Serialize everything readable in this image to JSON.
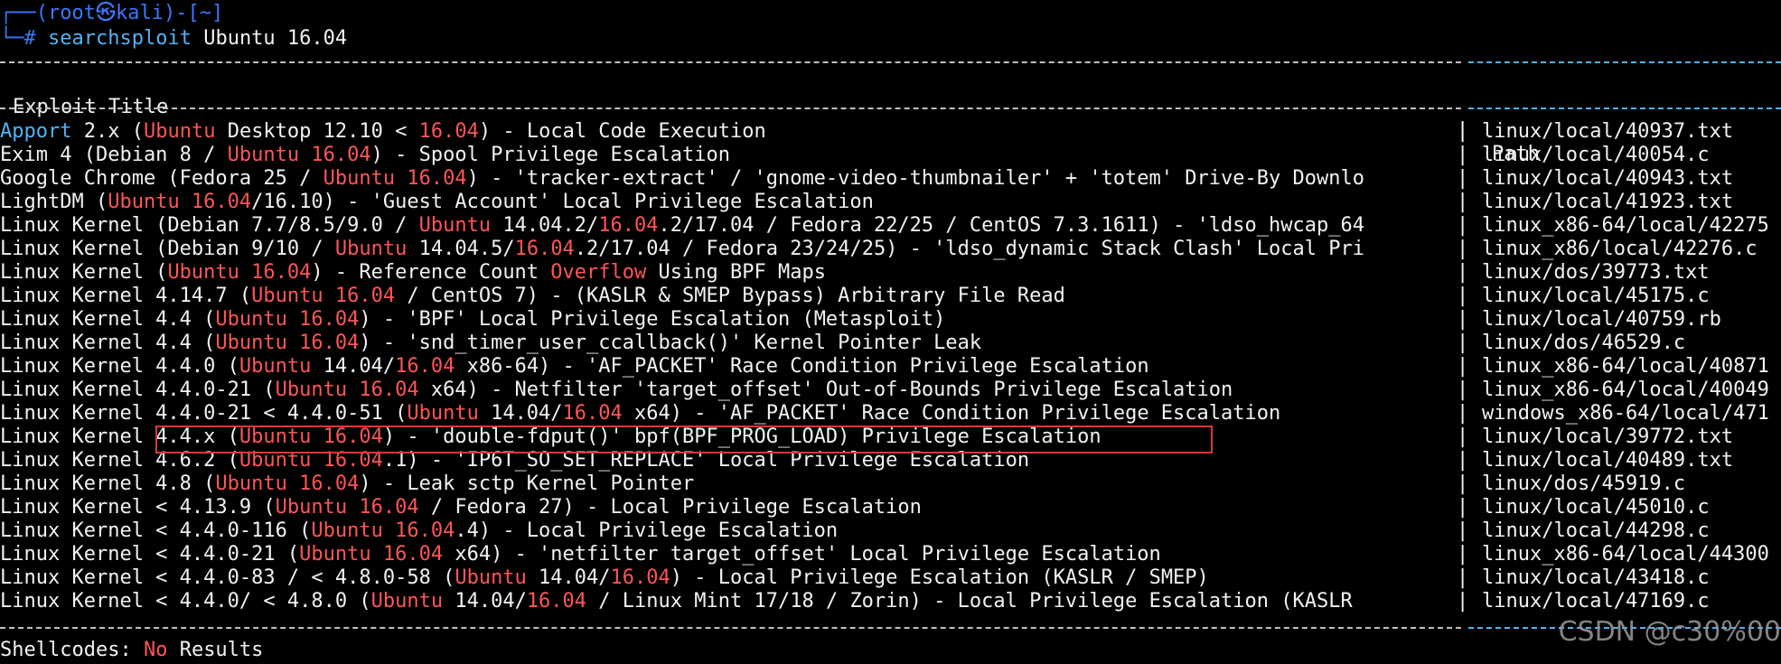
{
  "prompt": {
    "line1_prefix": "┌──(",
    "user": "root",
    "at_symbol": "㉿",
    "host": "kali",
    "line1_mid": ")-[",
    "cwd": "~",
    "line1_suffix": "]",
    "line2_prefix": "└─",
    "hash": "#",
    "command": "searchsploit",
    "argument": "Ubuntu 16.04"
  },
  "table": {
    "header_title": "Exploit Title",
    "header_path": "Path",
    "separator": "|",
    "rows": [
      {
        "title": [
          {
            "t": "Apport",
            "c": "apport"
          },
          {
            "t": " 2.x ("
          },
          {
            "t": "Ubuntu",
            "c": "hl"
          },
          {
            "t": " Desktop 12.10 < "
          },
          {
            "t": "16.04",
            "c": "hl"
          },
          {
            "t": ") - Local Code Execution"
          }
        ],
        "path": "linux/local/40937.txt"
      },
      {
        "title": [
          {
            "t": "Exim 4 (Debian 8 / "
          },
          {
            "t": "Ubuntu 16.04",
            "c": "hl"
          },
          {
            "t": ") - Spool Privilege Escalation"
          }
        ],
        "path": "linux/local/40054.c"
      },
      {
        "title": [
          {
            "t": "Google Chrome (Fedora 25 / "
          },
          {
            "t": "Ubuntu 16.04",
            "c": "hl"
          },
          {
            "t": ") - 'tracker-extract' / 'gnome-video-thumbnailer' + 'totem' Drive-By Downlo"
          }
        ],
        "path": "linux/local/40943.txt"
      },
      {
        "title": [
          {
            "t": "LightDM ("
          },
          {
            "t": "Ubuntu 16.04",
            "c": "hl"
          },
          {
            "t": "/16.10) - 'Guest Account' Local Privilege Escalation"
          }
        ],
        "path": "linux/local/41923.txt"
      },
      {
        "title": [
          {
            "t": "Linux Kernel (Debian 7.7/8.5/9.0 / "
          },
          {
            "t": "Ubuntu",
            "c": "hl"
          },
          {
            "t": " 14.04.2/"
          },
          {
            "t": "16.04",
            "c": "hl"
          },
          {
            "t": ".2/17.04 / Fedora 22/25 / CentOS 7.3.1611) - 'ldso_hwcap_64"
          }
        ],
        "path": "linux_x86-64/local/42275"
      },
      {
        "title": [
          {
            "t": "Linux Kernel (Debian 9/10 / "
          },
          {
            "t": "Ubuntu",
            "c": "hl"
          },
          {
            "t": " 14.04.5/"
          },
          {
            "t": "16.04",
            "c": "hl"
          },
          {
            "t": ".2/17.04 / Fedora 23/24/25) - 'ldso_dynamic Stack Clash' Local Pri"
          }
        ],
        "path": "linux_x86/local/42276.c"
      },
      {
        "title": [
          {
            "t": "Linux Kernel ("
          },
          {
            "t": "Ubuntu 16.04",
            "c": "hl"
          },
          {
            "t": ") - Reference Count "
          },
          {
            "t": "Overflow",
            "c": "hl"
          },
          {
            "t": " Using BPF Maps"
          }
        ],
        "path": "linux/dos/39773.txt"
      },
      {
        "title": [
          {
            "t": "Linux Kernel 4.14.7 ("
          },
          {
            "t": "Ubuntu 16.04",
            "c": "hl"
          },
          {
            "t": " / CentOS 7) - (KASLR & SMEP Bypass) Arbitrary File Read"
          }
        ],
        "path": "linux/local/45175.c"
      },
      {
        "title": [
          {
            "t": "Linux Kernel 4.4 ("
          },
          {
            "t": "Ubuntu 16.04",
            "c": "hl"
          },
          {
            "t": ") - 'BPF' Local Privilege Escalation (Metasploit)"
          }
        ],
        "path": "linux/local/40759.rb"
      },
      {
        "title": [
          {
            "t": "Linux Kernel 4.4 ("
          },
          {
            "t": "Ubuntu 16.04",
            "c": "hl"
          },
          {
            "t": ") - 'snd_timer_user_ccallback()' Kernel Pointer Leak"
          }
        ],
        "path": "linux/dos/46529.c"
      },
      {
        "title": [
          {
            "t": "Linux Kernel 4.4.0 ("
          },
          {
            "t": "Ubuntu",
            "c": "hl"
          },
          {
            "t": " 14.04/"
          },
          {
            "t": "16.04",
            "c": "hl"
          },
          {
            "t": " x86-64) - 'AF_PACKET' Race Condition Privilege Escalation"
          }
        ],
        "path": "linux_x86-64/local/40871"
      },
      {
        "title": [
          {
            "t": "Linux Kernel 4.4.0-21 ("
          },
          {
            "t": "Ubuntu 16.04",
            "c": "hl"
          },
          {
            "t": " x64) - Netfilter 'target_offset' Out-of-Bounds Privilege Escalation"
          }
        ],
        "path": "linux_x86-64/local/40049"
      },
      {
        "title": [
          {
            "t": "Linux Kernel 4.4.0-21 < 4.4.0-51 ("
          },
          {
            "t": "Ubuntu",
            "c": "hl"
          },
          {
            "t": " 14.04/"
          },
          {
            "t": "16.04",
            "c": "hl"
          },
          {
            "t": " x64) - 'AF_PACKET' Race Condition Privilege Escalation"
          }
        ],
        "path": "windows_x86-64/local/471"
      },
      {
        "title": [
          {
            "t": "Linux Kernel 4.4.x ("
          },
          {
            "t": "Ubuntu 16.04",
            "c": "hl"
          },
          {
            "t": ") - 'double-fdput()' bpf(BPF_PROG_LOAD) Privilege Escalation"
          }
        ],
        "path": "linux/local/39772.txt"
      },
      {
        "title": [
          {
            "t": "Linux Kernel 4.6.2 ("
          },
          {
            "t": "Ubuntu 16.04",
            "c": "hl"
          },
          {
            "t": ".1) - 'IP6T_SO_SET_REPLACE' Local Privilege Escalation"
          }
        ],
        "path": "linux/local/40489.txt"
      },
      {
        "title": [
          {
            "t": "Linux Kernel 4.8 ("
          },
          {
            "t": "Ubuntu 16.04",
            "c": "hl"
          },
          {
            "t": ") - Leak sctp Kernel Pointer"
          }
        ],
        "path": "linux/dos/45919.c"
      },
      {
        "title": [
          {
            "t": "Linux Kernel < 4.13.9 ("
          },
          {
            "t": "Ubuntu 16.04",
            "c": "hl"
          },
          {
            "t": " / Fedora 27) - Local Privilege Escalation"
          }
        ],
        "path": "linux/local/45010.c"
      },
      {
        "title": [
          {
            "t": "Linux Kernel < 4.4.0-116 ("
          },
          {
            "t": "Ubuntu 16.04",
            "c": "hl"
          },
          {
            "t": ".4) - Local Privilege Escalation"
          }
        ],
        "path": "linux/local/44298.c"
      },
      {
        "title": [
          {
            "t": "Linux Kernel < 4.4.0-21 ("
          },
          {
            "t": "Ubuntu 16.04",
            "c": "hl"
          },
          {
            "t": " x64) - 'netfilter target_offset' Local Privilege Escalation"
          }
        ],
        "path": "linux_x86-64/local/44300"
      },
      {
        "title": [
          {
            "t": "Linux Kernel < 4.4.0-83 / < 4.8.0-58 ("
          },
          {
            "t": "Ubuntu",
            "c": "hl"
          },
          {
            "t": " 14.04/"
          },
          {
            "t": "16.04",
            "c": "hl"
          },
          {
            "t": ") - Local Privilege Escalation (KASLR / SMEP)"
          }
        ],
        "path": "linux/local/43418.c"
      },
      {
        "title": [
          {
            "t": "Linux Kernel < 4.4.0/ < 4.8.0 ("
          },
          {
            "t": "Ubuntu",
            "c": "hl"
          },
          {
            "t": " 14.04/"
          },
          {
            "t": "16.04",
            "c": "hl"
          },
          {
            "t": " / Linux Mint 17/18 / Zorin) - Local Privilege Escalation (KASLR"
          }
        ],
        "path": "linux/local/47169.c"
      }
    ]
  },
  "shellcodes": {
    "label": "Shellcodes: ",
    "status": "No",
    "suffix": " Results"
  },
  "watermark": "CSDN @c30%00",
  "colors": {
    "background": "#000000",
    "text": "#f2f2f2",
    "prompt_blue": "#3b78ff",
    "command_cyan": "#4fb3f7",
    "match_red": "#ff5555",
    "highlight_box": "#d93838"
  }
}
